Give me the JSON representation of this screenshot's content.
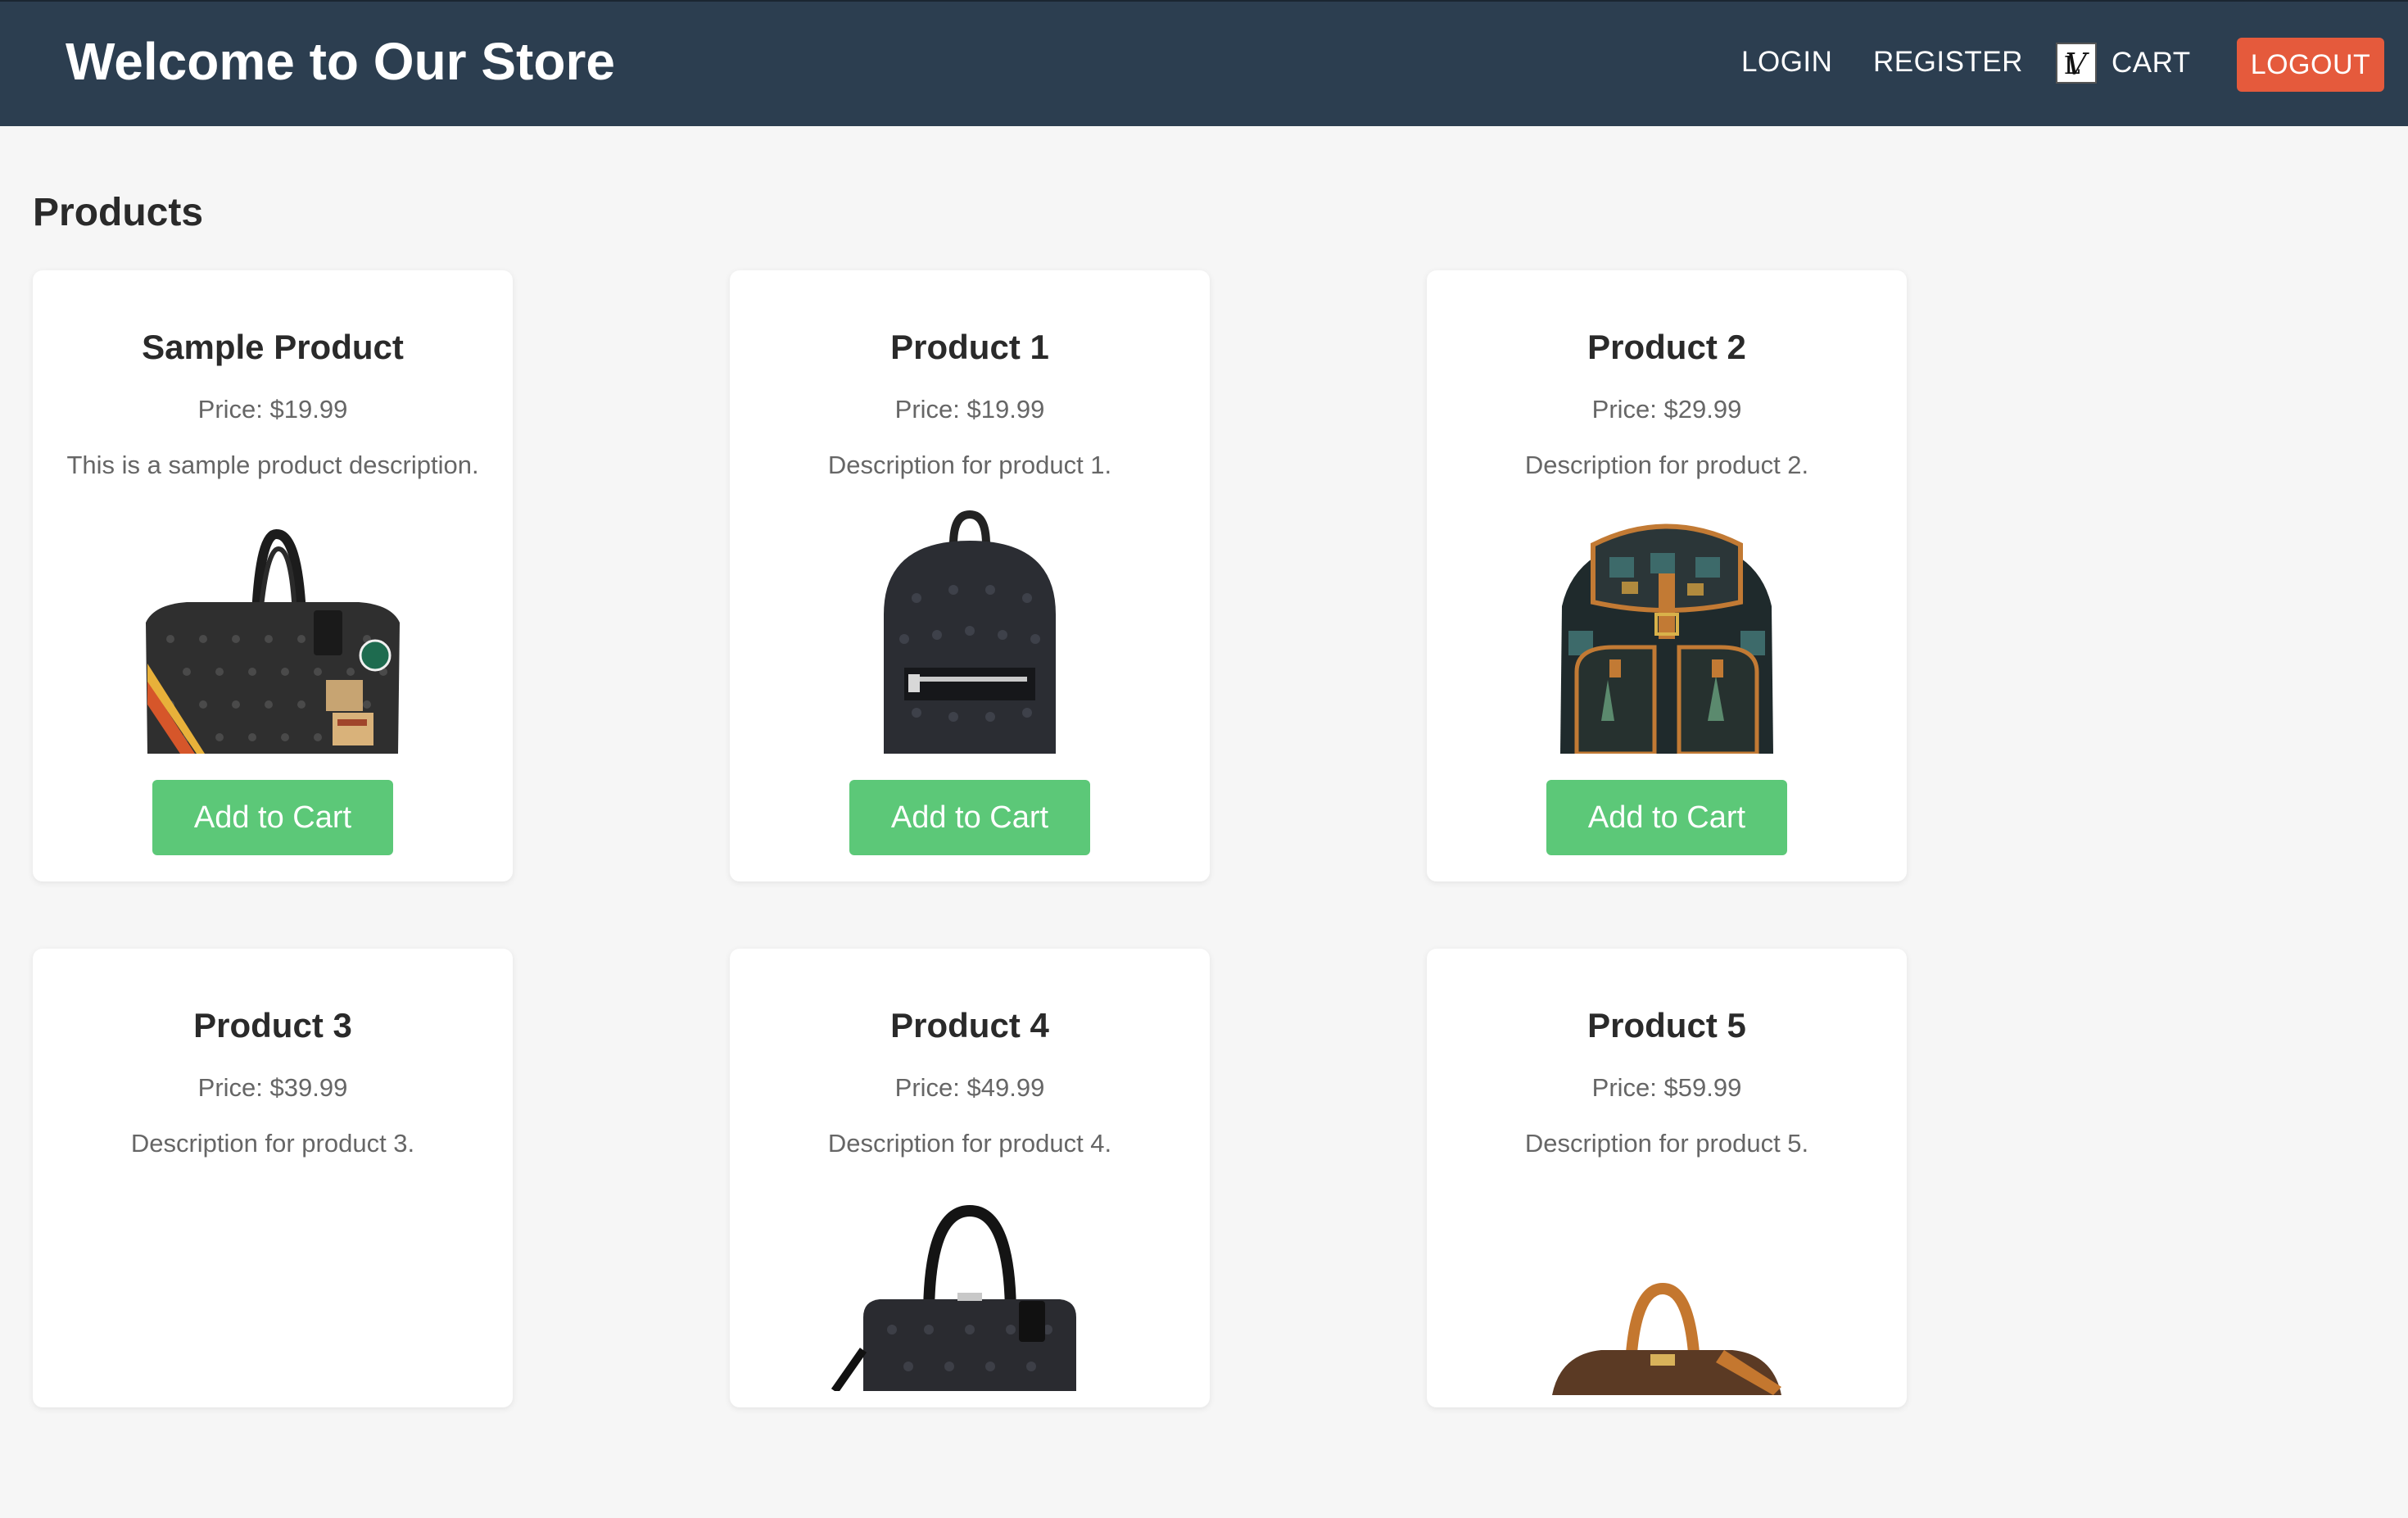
{
  "header": {
    "title": "Welcome to Our Store",
    "nav": {
      "login": "LOGIN",
      "register": "REGISTER",
      "cart": "CART",
      "logout": "LOGOUT"
    }
  },
  "main": {
    "section_title": "Products",
    "add_to_cart_label": "Add to Cart",
    "products": [
      {
        "name": "Sample Product",
        "price": "Price: $19.99",
        "description": "This is a sample product description.",
        "image": "duffel-bag-image"
      },
      {
        "name": "Product 1",
        "price": "Price: $19.99",
        "description": "Description for product 1.",
        "image": "backpack-image"
      },
      {
        "name": "Product 2",
        "price": "Price: $29.99",
        "description": "Description for product 2.",
        "image": "patterned-backpack-image"
      },
      {
        "name": "Product 3",
        "price": "Price: $39.99",
        "description": "Description for product 3.",
        "image": ""
      },
      {
        "name": "Product 4",
        "price": "Price: $49.99",
        "description": "Description for product 4.",
        "image": "briefcase-image"
      },
      {
        "name": "Product 5",
        "price": "Price: $59.99",
        "description": "Description for product 5.",
        "image": "brown-bag-image"
      }
    ]
  },
  "colors": {
    "header_bg": "#2c3e50",
    "logout_bg": "#e55a3c",
    "add_to_cart_bg": "#5cc878",
    "page_bg": "#f6f6f6"
  }
}
